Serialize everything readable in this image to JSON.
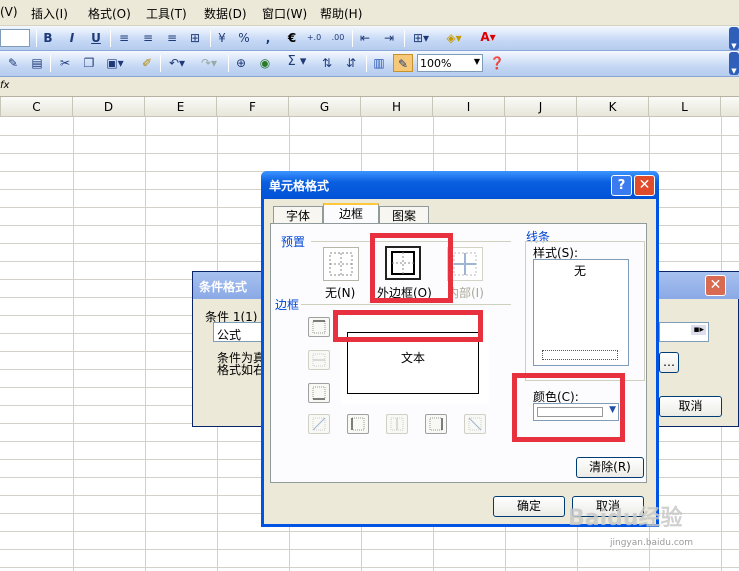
{
  "menu": [
    "(V)",
    "插入(I)",
    "格式(O)",
    "工具(T)",
    "数据(D)",
    "窗口(W)",
    "帮助(H)"
  ],
  "toolbar": {
    "zoom": "100%",
    "percent": "%",
    "comma": ",",
    "euro": "€",
    "inc_decimal": "+.0",
    "dec_decimal": ".00",
    "bold": "B",
    "italic": "I",
    "underline": "U",
    "sigma": "Σ"
  },
  "formula_bar": {
    "fx": "fx"
  },
  "columns": [
    "C",
    "D",
    "E",
    "F",
    "G",
    "H",
    "I",
    "J",
    "K",
    "L"
  ],
  "cf_dialog": {
    "title": "条件格式",
    "condition_label": "条件 1(1)",
    "type_value": "公式",
    "desc_line1": "条件为真",
    "desc_line2": "格式如右",
    "cancel": "取消"
  },
  "fmt_dialog": {
    "title": "单元格格式",
    "tabs": [
      "字体",
      "边框",
      "图案"
    ],
    "active_tab": "边框",
    "preset_label": "预置",
    "presets": [
      "无(N)",
      "外边框(O)",
      "内部(I)"
    ],
    "border_label": "边框",
    "preview_text": "文本",
    "line_label": "线条",
    "style_label": "样式(S):",
    "style_none": "无",
    "color_label": "颜色(C):",
    "clear_button": "清除(R)",
    "ok_button": "确定",
    "cancel_button": "取消"
  },
  "watermark": {
    "brand": "Baidu经验",
    "url": "jingyan.baidu.com"
  },
  "colors": {
    "highlight": "#e8313f",
    "titlebar": "#0a5fe0",
    "dialog_bg": "#ECE9D8",
    "group_label": "#0046d5"
  }
}
